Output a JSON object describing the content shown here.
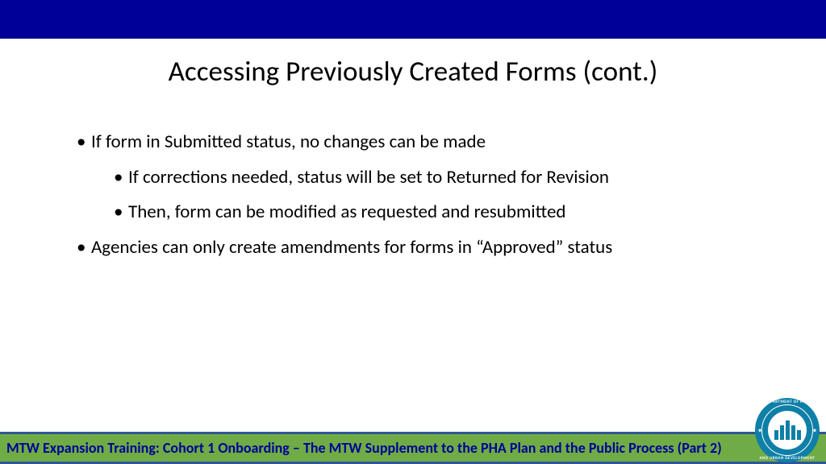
{
  "title": "Accessing Previously Created Forms (cont.)",
  "bullets": {
    "item1": "If form in Submitted status, no changes can be made",
    "item1_sub1": "If corrections needed, status will be set to Returned for Revision",
    "item1_sub2": "Then, form can be modified as requested and resubmitted",
    "item2": "Agencies can only create amendments for forms in “Approved” status"
  },
  "footer": "MTW Expansion Training: Cohort 1 Onboarding – The MTW Supplement to the PHA Plan and the Public Process (Part 2)",
  "seal": {
    "top_text": "U.S. DEPARTMENT OF HOUSING",
    "bottom_text": "AND URBAN DEVELOPMENT"
  },
  "colors": {
    "header_blue": "#000099",
    "footer_green": "#6fac46",
    "footer_border": "#2f5597",
    "seal_teal": "#0e7fa7"
  }
}
